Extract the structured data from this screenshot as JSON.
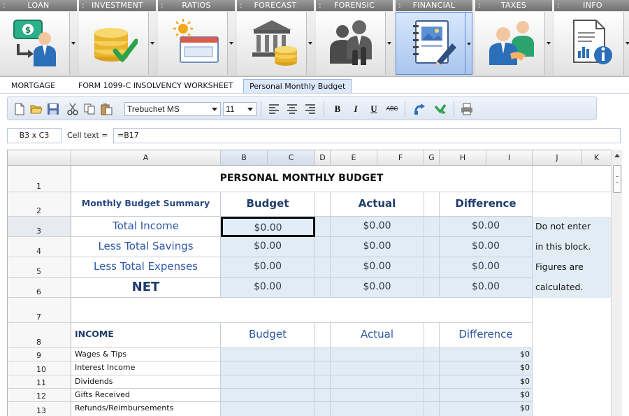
{
  "ribbon": {
    "tabs": [
      {
        "label": "LOAN",
        "icon": "loan-money-person-icon"
      },
      {
        "label": "INVESTMENT",
        "icon": "coins-check-icon"
      },
      {
        "label": "RATIOS",
        "icon": "sun-card-icon"
      },
      {
        "label": "FORECAST",
        "icon": "bank-coins-icon"
      },
      {
        "label": "FORENSIC",
        "icon": "people-chess-icon"
      },
      {
        "label": "FINANCIAL",
        "icon": "notebook-pen-icon",
        "active": true
      },
      {
        "label": "TAXES",
        "icon": "people-handshake-icon"
      },
      {
        "label": "INFO",
        "icon": "document-info-icon"
      }
    ]
  },
  "sheet_tabs": [
    {
      "label": "MORTGAGE"
    },
    {
      "label": "FORM 1099-C INSOLVENCY WORKSHEET"
    },
    {
      "label": "Personal Monthly Budget",
      "active": true
    }
  ],
  "toolbar": {
    "font_name": "Trebuchet MS",
    "font_size": "11",
    "bold_label": "B",
    "italic_label": "I",
    "underline_label": "U",
    "strike_label": "ABC"
  },
  "formula_bar": {
    "cell_ref": "B3 x C3",
    "cell_text_label": "Cell text =",
    "cell_text": "=B17"
  },
  "grid": {
    "columns": [
      "A",
      "B",
      "C",
      "D",
      "E",
      "F",
      "G",
      "H",
      "I",
      "J",
      "K"
    ],
    "rows": [
      "1",
      "2",
      "3",
      "4",
      "5",
      "6",
      "7",
      "8",
      "9",
      "10",
      "11",
      "12",
      "13"
    ],
    "title": "PERSONAL MONTHLY BUDGET",
    "summary": {
      "header_label": "Monthly Budget Summary",
      "col_budget": "Budget",
      "col_actual": "Actual",
      "col_difference": "Difference",
      "rows": [
        {
          "label": "Total Income",
          "budget": "$0.00",
          "actual": "$0.00",
          "difference": "$0.00"
        },
        {
          "label": "Less Total Savings",
          "budget": "$0.00",
          "actual": "$0.00",
          "difference": "$0.00"
        },
        {
          "label": "Less Total Expenses",
          "budget": "$0.00",
          "actual": "$0.00",
          "difference": "$0.00"
        },
        {
          "label": "NET",
          "budget": "$0.00",
          "actual": "$0.00",
          "difference": "$0.00"
        }
      ]
    },
    "note_lines": [
      "Do not enter",
      "in this block.",
      "Figures are",
      "calculated."
    ],
    "income": {
      "header": "INCOME",
      "col_budget": "Budget",
      "col_actual": "Actual",
      "col_difference": "Difference",
      "items": [
        {
          "label": "Wages & Tips",
          "difference": "$0"
        },
        {
          "label": "Interest Income",
          "difference": "$0"
        },
        {
          "label": "Dividends",
          "difference": "$0"
        },
        {
          "label": "Gifts Received",
          "difference": "$0"
        },
        {
          "label": "Refunds/Reimbursements",
          "difference": "$0"
        }
      ]
    }
  },
  "colors": {
    "accent": "#2d58a6",
    "heading": "#1f3d6b",
    "shade": "#e2ecf4",
    "active_tab": "#a9c6f0"
  }
}
